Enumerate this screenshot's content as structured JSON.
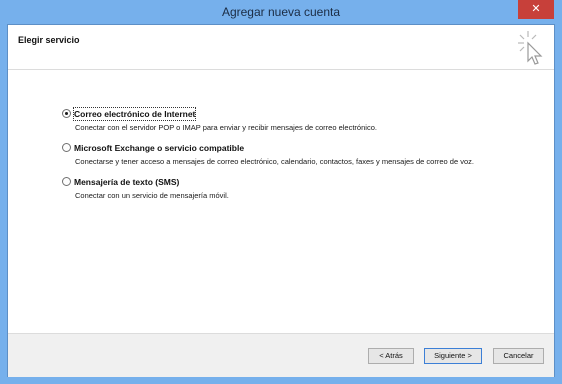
{
  "window": {
    "title": "Agregar nueva cuenta",
    "close_label": "✕"
  },
  "header": {
    "title": "Elegir servicio",
    "icon": "cursor-click-icon"
  },
  "options": [
    {
      "label": "Correo electrónico de Internet",
      "description": "Conectar con el servidor POP o IMAP para enviar y recibir mensajes de correo electrónico.",
      "selected": true
    },
    {
      "label": "Microsoft Exchange o servicio compatible",
      "description": "Conectarse y tener acceso a mensajes de correo electrónico, calendario, contactos, faxes y mensajes de correo de voz.",
      "selected": false
    },
    {
      "label": "Mensajería de texto (SMS)",
      "description": "Conectar con un servicio de mensajería móvil.",
      "selected": false
    }
  ],
  "footer": {
    "back_label": "< Atrás",
    "next_label": "Siguiente >",
    "cancel_label": "Cancelar"
  },
  "colors": {
    "frame": "#76b0ec",
    "close": "#c7403a",
    "default_button_border": "#3c7fd6"
  }
}
